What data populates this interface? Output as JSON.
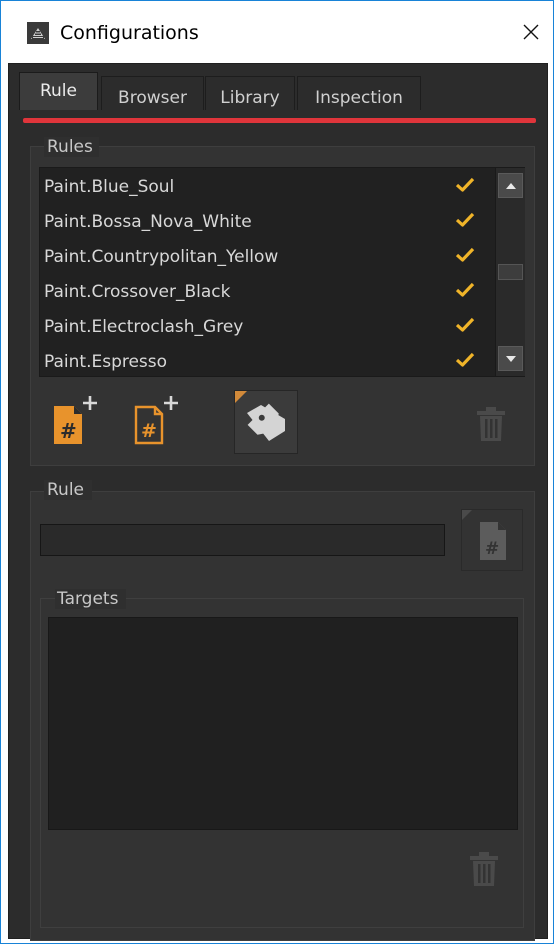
{
  "window": {
    "title": "Configurations",
    "close_symbol": "✕",
    "accent_color": "#e0353b",
    "check_color": "#f0b429",
    "icon_orange": "#e8932c"
  },
  "tabs": [
    {
      "label": "Rule",
      "active": true
    },
    {
      "label": "Browser",
      "active": false
    },
    {
      "label": "Library",
      "active": false
    },
    {
      "label": "Inspection",
      "active": false
    }
  ],
  "rules_panel": {
    "label": "Rules",
    "items": [
      {
        "name": "Paint.Blue_Soul",
        "checked": true
      },
      {
        "name": "Paint.Bossa_Nova_White",
        "checked": true
      },
      {
        "name": "Paint.Countrypolitan_Yellow",
        "checked": true
      },
      {
        "name": "Paint.Crossover_Black",
        "checked": true
      },
      {
        "name": "Paint.Electroclash_Grey",
        "checked": true
      },
      {
        "name": "Paint.Espresso",
        "checked": true
      }
    ],
    "toolbar_icons": [
      "add-rule-icon",
      "add-rule-copy-icon",
      "tag-icon",
      "trash-icon"
    ]
  },
  "rule_panel": {
    "label": "Rule",
    "name_value": "",
    "targets_label": "Targets",
    "targets": []
  }
}
